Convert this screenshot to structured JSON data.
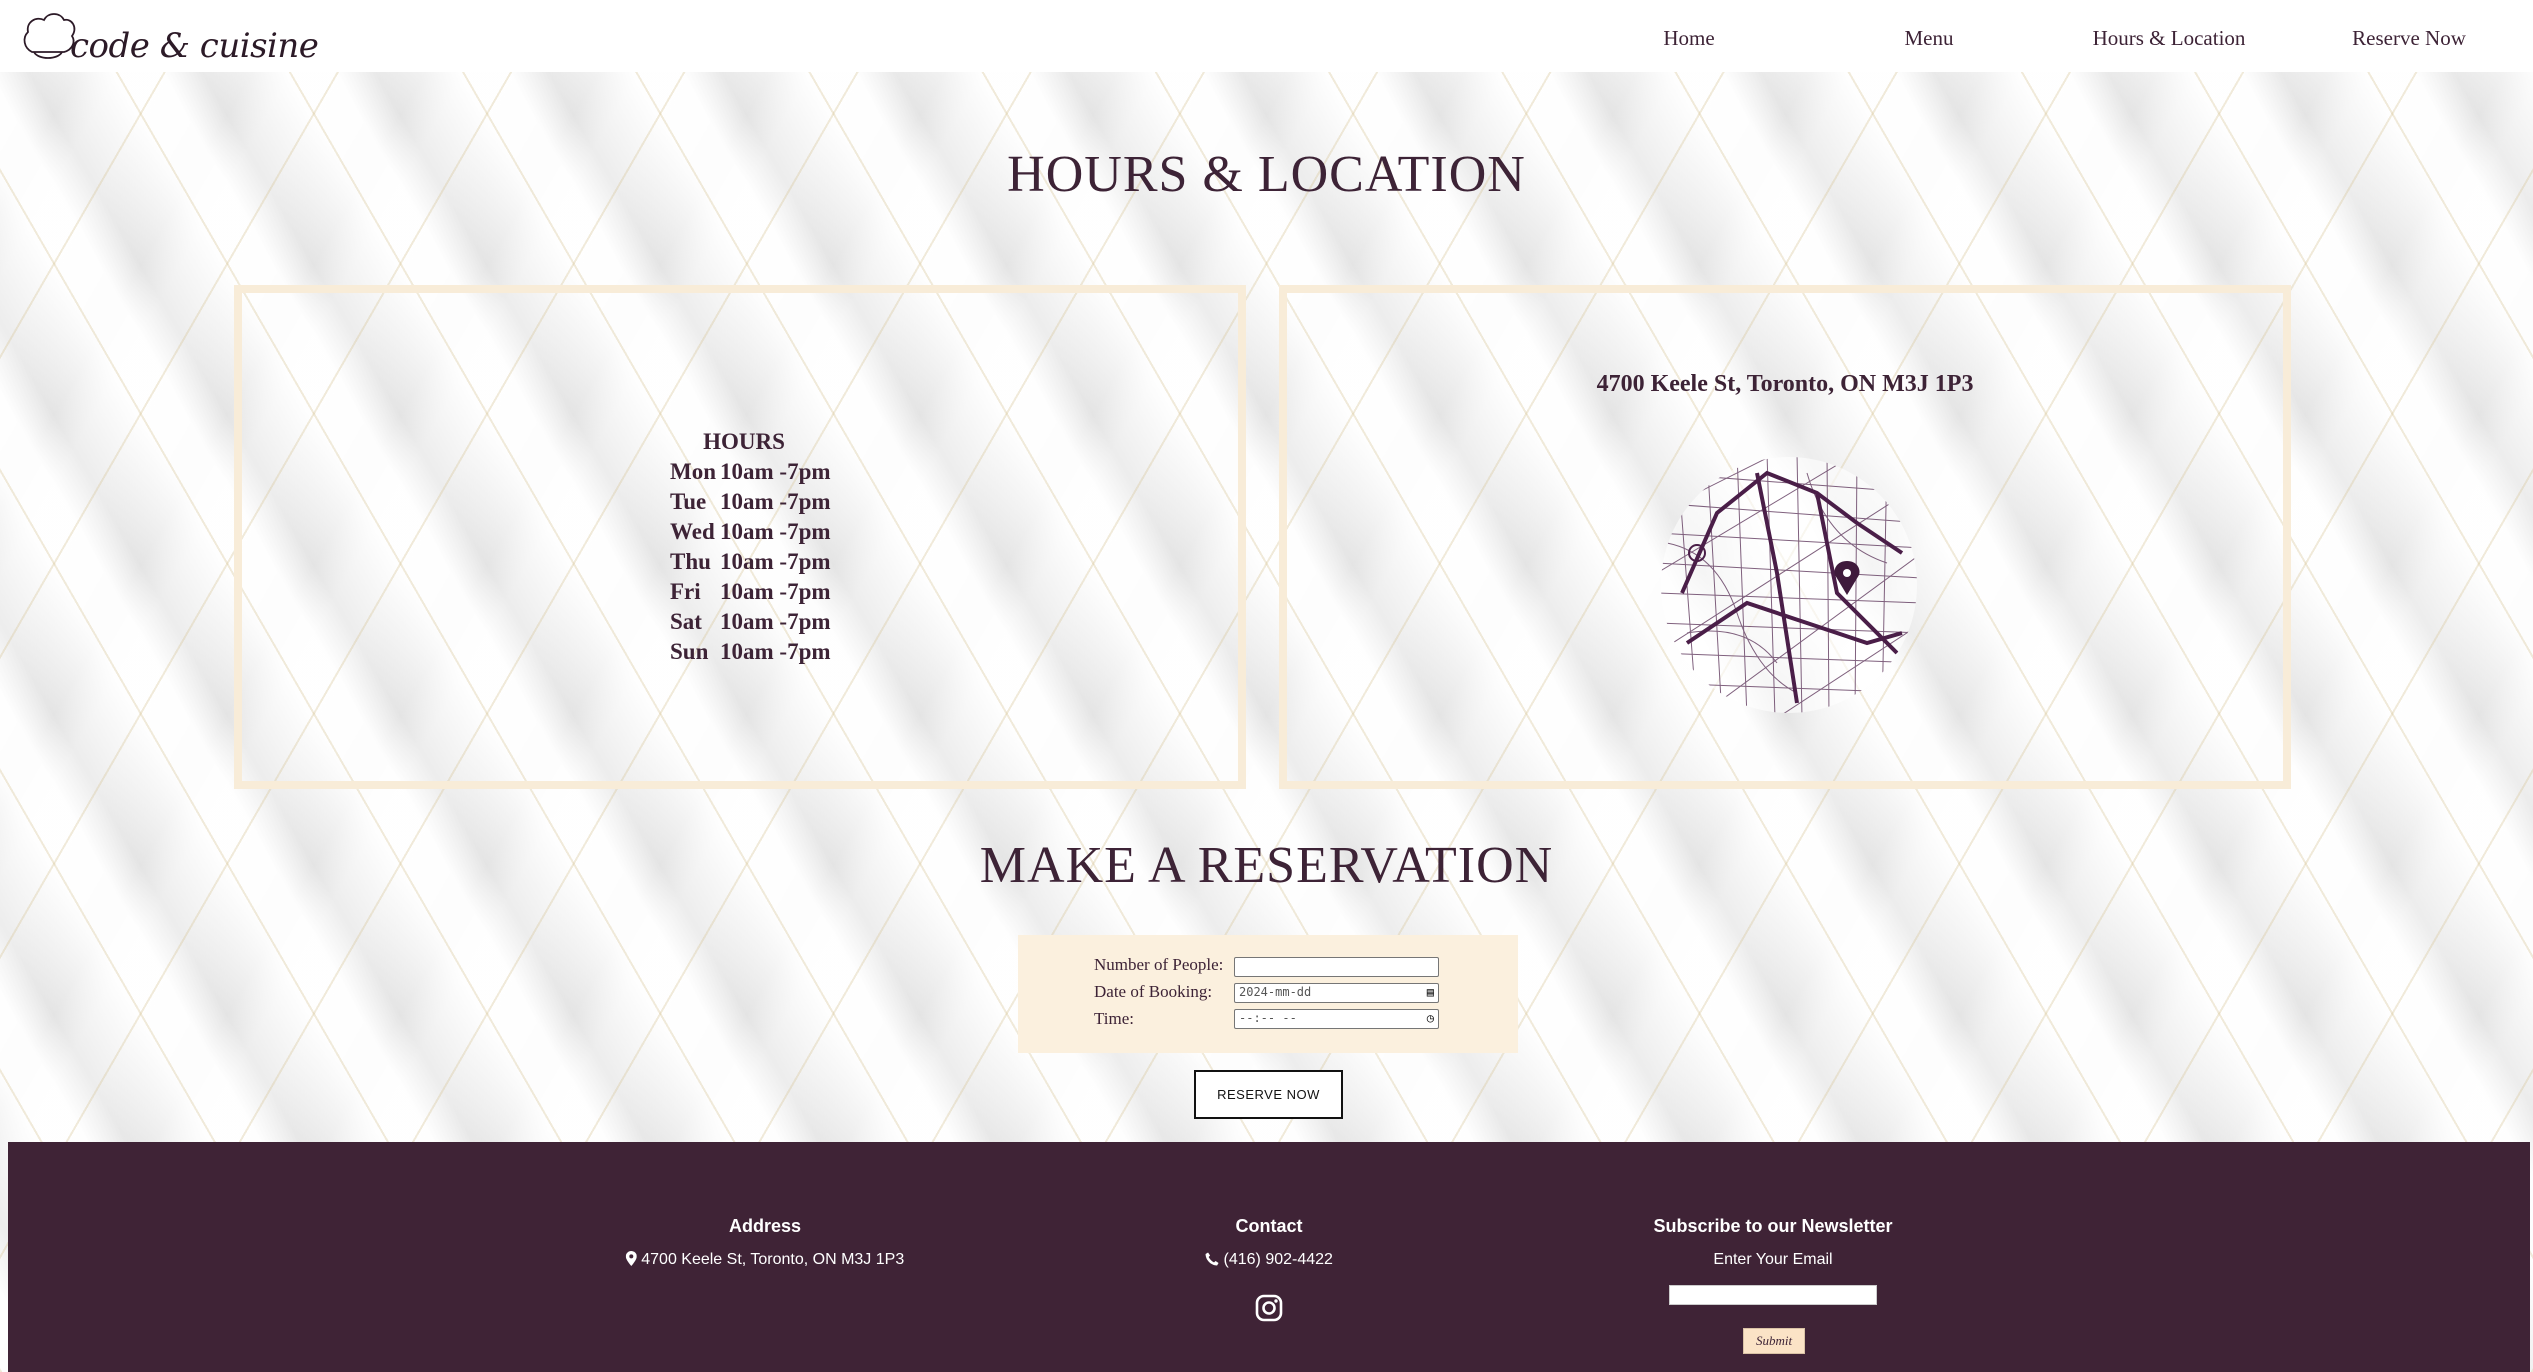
{
  "brand": {
    "logo_text": "code & cuisine"
  },
  "nav": {
    "items": [
      "Home",
      "Menu",
      "Hours & Location",
      "Reserve Now"
    ]
  },
  "hours_location": {
    "title": "HOURS & LOCATION",
    "hours_heading": "HOURS",
    "hours": [
      {
        "day": "Mon",
        "time": "10am -7pm"
      },
      {
        "day": "Tue",
        "time": "10am -7pm"
      },
      {
        "day": "Wed",
        "time": "10am -7pm"
      },
      {
        "day": "Thu",
        "time": "10am -7pm"
      },
      {
        "day": "Fri",
        "time": "10am -7pm"
      },
      {
        "day": "Sat",
        "time": "10am -7pm"
      },
      {
        "day": "Sun",
        "time": "10am -7pm"
      }
    ],
    "address": "4700 Keele St, Toronto, ON M3J 1P3"
  },
  "reservation": {
    "title": "MAKE A RESERVATION",
    "people_label": "Number of People:",
    "people_value": "",
    "date_label": "Date of Booking:",
    "date_value": "2024-mm-dd",
    "time_label": "Time:",
    "time_value": "--:-- --",
    "button_label": "RESERVE NOW"
  },
  "footer": {
    "address_heading": "Address",
    "address": "4700 Keele St, Toronto, ON M3J 1P3",
    "contact_heading": "Contact",
    "phone": "(416) 902-4422",
    "newsletter_heading": "Subscribe to our Newsletter",
    "newsletter_prompt": "Enter Your Email",
    "newsletter_value": "",
    "submit_label": "Submit"
  },
  "colors": {
    "brand_plum": "#3f2336",
    "panel_border": "#f8ecd8",
    "form_background": "#fbf0de"
  }
}
